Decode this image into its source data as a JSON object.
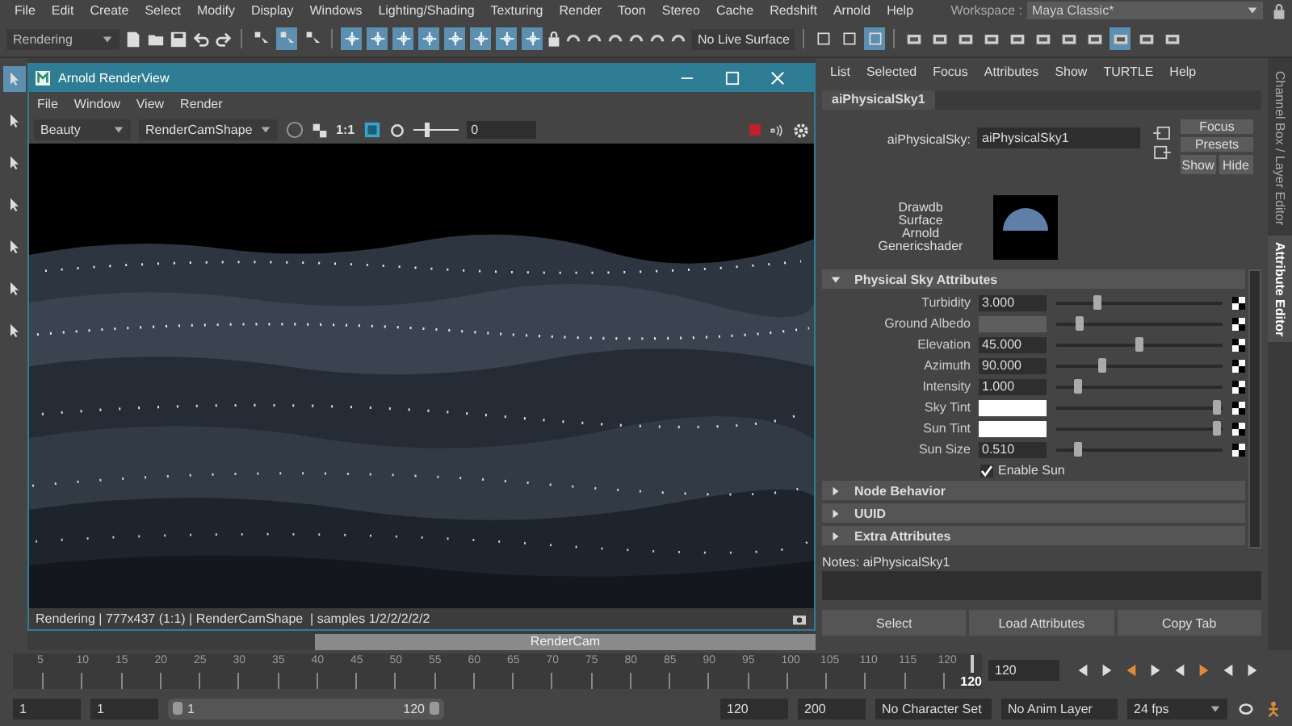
{
  "menu_bar": {
    "items": [
      "File",
      "Edit",
      "Create",
      "Select",
      "Modify",
      "Display",
      "Windows",
      "Lighting/Shading",
      "Texturing",
      "Render",
      "Toon",
      "Stereo",
      "Cache",
      "Redshift",
      "Arnold",
      "Help"
    ],
    "workspace_label": "Workspace :",
    "workspace": "Maya Classic*"
  },
  "toolbar": {
    "menu_set": "Rendering",
    "select_toggles": [
      {
        "on": false
      },
      {
        "on": true
      },
      {
        "on": false
      }
    ],
    "snap_toggles": [
      {
        "on": true
      },
      {
        "on": true
      },
      {
        "on": true
      },
      {
        "on": true
      },
      {
        "on": true
      },
      {
        "on": true
      },
      {
        "on": true
      },
      {
        "on": true
      }
    ],
    "live_surface": "No Live Surface",
    "panel_toggles": [
      {
        "on": false
      },
      {
        "on": false
      },
      {
        "on": true
      }
    ],
    "editor_toggles": [
      {
        "on": false
      },
      {
        "on": false
      },
      {
        "on": false
      },
      {
        "on": false
      },
      {
        "on": false
      },
      {
        "on": false
      },
      {
        "on": false
      },
      {
        "on": false
      },
      {
        "on": true
      },
      {
        "on": false
      },
      {
        "on": false
      }
    ]
  },
  "tool_box": [
    {
      "selected": true
    },
    {
      "selected": false
    },
    {
      "selected": false
    },
    {
      "selected": false
    },
    {
      "selected": false
    },
    {
      "selected": false
    },
    {
      "selected": false
    }
  ],
  "viewport": {
    "camera_label": "RenderCam"
  },
  "render_view": {
    "title": "Arnold RenderView",
    "menu": [
      "File",
      "Window",
      "View",
      "Render"
    ],
    "aov": "Beauty",
    "camera": "RenderCamShape",
    "ratio": "1:1",
    "exposure": {
      "level": 0.35,
      "value": "0"
    },
    "status": "Rendering | 777x437 (1:1) | RenderCamShape  | samples 1/2/2/2/2/2"
  },
  "attribute_editor": {
    "menu": [
      "List",
      "Selected",
      "Focus",
      "Attributes",
      "Show",
      "TURTLE",
      "Help"
    ],
    "tab": "aiPhysicalSky1",
    "node_label": "aiPhysicalSky:",
    "node_name": "aiPhysicalSky1",
    "focus_button": "Focus",
    "presets_button": "Presets",
    "show_button": "Show",
    "hide_button": "Hide",
    "swatch_labels": [
      "Drawdb",
      "Surface",
      "Arnold",
      "Genericshader"
    ],
    "section": {
      "title": "Physical Sky Attributes",
      "expanded": true
    },
    "attributes": [
      {
        "label": "Turbidity",
        "kind": "number",
        "value": "3.000",
        "level": 0.24
      },
      {
        "label": "Ground Albedo",
        "kind": "swatch",
        "color": "#5e5e5e",
        "level": 0.12
      },
      {
        "label": "Elevation",
        "kind": "number",
        "value": "45.000",
        "level": 0.51
      },
      {
        "label": "Azimuth",
        "kind": "number",
        "value": "90.000",
        "level": 0.27
      },
      {
        "label": "Intensity",
        "kind": "number",
        "value": "1.000",
        "level": 0.11
      },
      {
        "label": "Sky Tint",
        "kind": "swatch",
        "color": "#ffffff",
        "level": 1
      },
      {
        "label": "Sun Tint",
        "kind": "swatch",
        "color": "#ffffff",
        "level": 1
      },
      {
        "label": "Sun Size",
        "kind": "number",
        "value": "0.510",
        "level": 0.11
      }
    ],
    "enable_sun": {
      "label": "Enable Sun",
      "checked": true
    },
    "collapsed_sections": [
      {
        "title": "Node Behavior",
        "expanded": false
      },
      {
        "title": "UUID",
        "expanded": false
      },
      {
        "title": "Extra Attributes",
        "expanded": false
      }
    ],
    "notes_label": "Notes:  aiPhysicalSky1",
    "bottom_buttons": [
      "Select",
      "Load Attributes",
      "Copy Tab"
    ]
  },
  "side_tabs": [
    {
      "label": "Channel Box / Layer Editor",
      "selected": false
    },
    {
      "label": "Attribute Editor",
      "selected": true
    }
  ],
  "timeline": {
    "ticks": [
      "5",
      "10",
      "15",
      "20",
      "25",
      "30",
      "35",
      "40",
      "45",
      "50",
      "55",
      "60",
      "65",
      "70",
      "75",
      "80",
      "85",
      "90",
      "95",
      "100",
      "105",
      "110",
      "115",
      "120"
    ],
    "current": "120",
    "current_field": "120",
    "level": 1
  },
  "range": {
    "start": "1",
    "playback_start": "1",
    "slider_start": "1",
    "slider_end": "120",
    "level": 1,
    "playback_end": "120",
    "end": "200",
    "character_set": "No Character Set",
    "anim_layer": "No Anim Layer",
    "fps": "24 fps"
  }
}
